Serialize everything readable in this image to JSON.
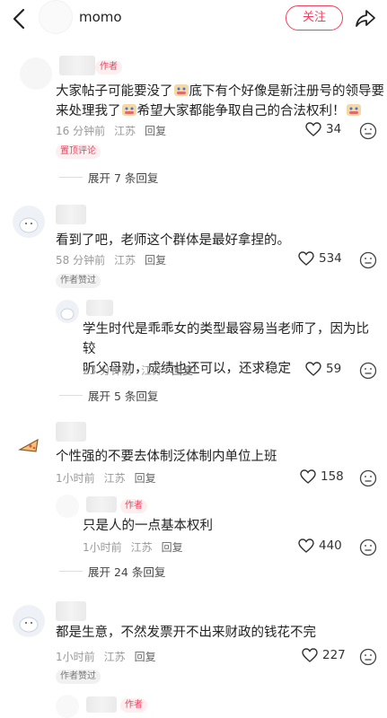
{
  "header": {
    "username": "momo",
    "follow_label": "关注"
  },
  "comments": [
    {
      "author_tag": "作者",
      "text_line1_a": "大家帖子可能要没了",
      "text_line1_b": "底下有个好像是新注册号的领导要",
      "text_line2_a": "来处理我了",
      "text_line2_b": "希望大家都能争取自己的合法权利！",
      "time": "16 分钟前",
      "location": "江苏",
      "reply_label": "回复",
      "likes": "34",
      "pin_tag": "置顶评论",
      "expand_label": "展开 7 条回复"
    },
    {
      "text": "看到了吧，老师这个群体是最好拿捏的。",
      "time": "58 分钟前",
      "location": "江苏",
      "reply_label": "回复",
      "likes": "534",
      "liked_tag": "作者赞过",
      "reply": {
        "text_line1": "学生时代是乖乖女的类型最容易当老师了，因为比较",
        "text_line2": "听父母劝，成绩也还可以，还求稳定",
        "time": "23 分钟前",
        "location": "江苏",
        "reply_label": "回复",
        "likes": "59"
      },
      "expand_label": "展开 5 条回复"
    },
    {
      "text": "个性强的不要去体制泛体制内单位上班",
      "time": "1小时前",
      "location": "江苏",
      "reply_label": "回复",
      "likes": "158",
      "reply": {
        "author_tag": "作者",
        "text": "只是人的一点基本权利",
        "time": "1小时前",
        "location": "江苏",
        "reply_label": "回复",
        "likes": "440"
      },
      "expand_label": "展开 24 条回复"
    },
    {
      "text": "都是生意，不然发票开不出来财政的钱花不完",
      "time": "1小时前",
      "location": "江苏",
      "reply_label": "回复",
      "likes": "227",
      "liked_tag": "作者赞过"
    },
    {
      "author_tag": "作者"
    }
  ],
  "icons": [
    "back-arrow-icon",
    "share-icon",
    "heart-icon",
    "dislike-face-icon",
    "crying-emoji-icon"
  ],
  "colors": {
    "accent": "#f0405d",
    "meta": "#999999",
    "text": "#222222"
  }
}
